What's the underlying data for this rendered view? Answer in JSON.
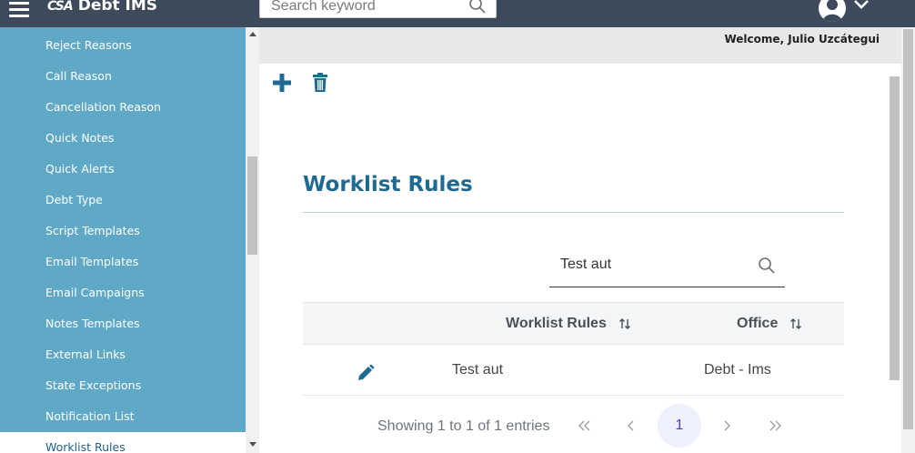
{
  "topbar": {
    "logo_mark": "CSA",
    "app_name": "Debt IMS",
    "search_placeholder": "Search keyword"
  },
  "sidebar": {
    "items": [
      {
        "label": "Reject Reasons"
      },
      {
        "label": "Call Reason"
      },
      {
        "label": "Cancellation Reason"
      },
      {
        "label": "Quick Notes"
      },
      {
        "label": "Quick Alerts"
      },
      {
        "label": "Debt Type"
      },
      {
        "label": "Script Templates"
      },
      {
        "label": "Email Templates"
      },
      {
        "label": "Email Campaigns"
      },
      {
        "label": "Notes Templates"
      },
      {
        "label": "External Links"
      },
      {
        "label": "State Exceptions"
      },
      {
        "label": "Notification List"
      },
      {
        "label": "Worklist Rules"
      }
    ]
  },
  "header": {
    "welcome": "Welcome, Julio Uzcátegui"
  },
  "main": {
    "title": "Worklist Rules",
    "filter_value": "Test aut",
    "table": {
      "columns": [
        "Worklist Rules",
        "Office"
      ],
      "rows": [
        {
          "rule": "Test aut",
          "office": "Debt - Ims"
        }
      ]
    },
    "paginator": {
      "info": "Showing 1 to 1 of 1 entries",
      "current_page": "1"
    }
  },
  "colors": {
    "topbar": "#3c4a5c",
    "sidebar": "#5fa9c7",
    "accent": "#1f6a93"
  }
}
